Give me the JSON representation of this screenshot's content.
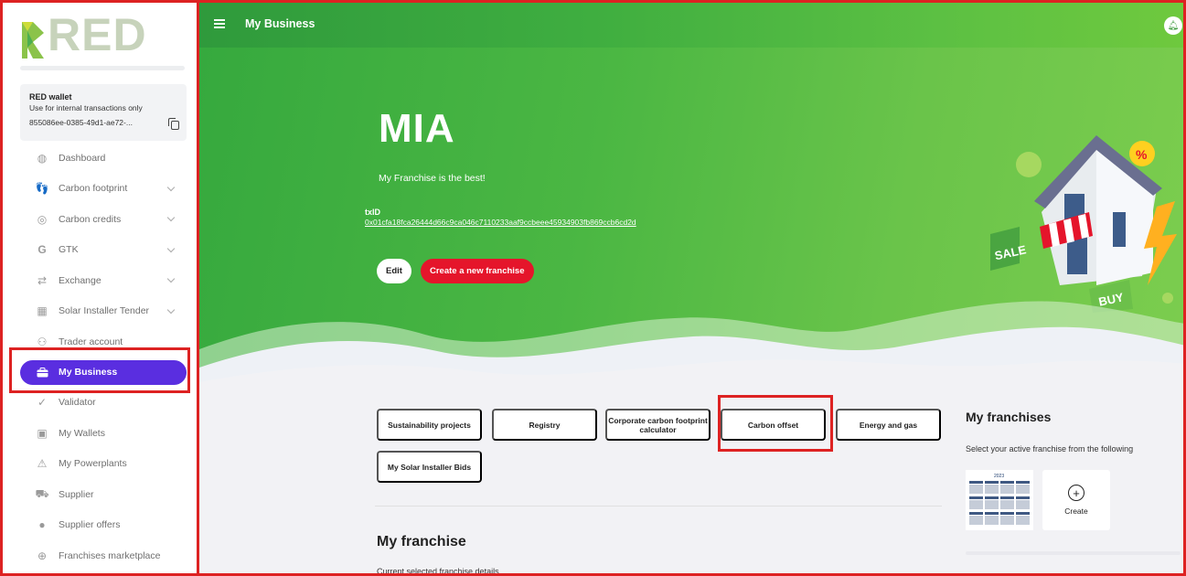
{
  "app": {
    "logo_text": "RED"
  },
  "wallet": {
    "title": "RED wallet",
    "subtitle": "Use for internal transactions only",
    "address": "855086ee-0385-49d1-ae72-..."
  },
  "sidebar": {
    "items": [
      {
        "label": "Dashboard",
        "icon": "dashboard-icon",
        "has_chevron": false
      },
      {
        "label": "Carbon footprint",
        "icon": "footprint-icon",
        "has_chevron": true
      },
      {
        "label": "Carbon credits",
        "icon": "credits-icon",
        "has_chevron": true
      },
      {
        "label": "GTK",
        "icon": "gtk-icon",
        "has_chevron": true
      },
      {
        "label": "Exchange",
        "icon": "exchange-icon",
        "has_chevron": true
      },
      {
        "label": "Solar Installer Tender",
        "icon": "solar-icon",
        "has_chevron": true
      },
      {
        "label": "Trader account",
        "icon": "trader-icon",
        "has_chevron": false
      },
      {
        "label": "My Business",
        "icon": "briefcase-icon",
        "has_chevron": false,
        "active": true
      },
      {
        "label": "Validator",
        "icon": "check-icon",
        "has_chevron": false
      },
      {
        "label": "My Wallets",
        "icon": "wallet-icon",
        "has_chevron": false
      },
      {
        "label": "My Powerplants",
        "icon": "powerplant-icon",
        "has_chevron": false
      },
      {
        "label": "Supplier",
        "icon": "truck-icon",
        "has_chevron": false
      },
      {
        "label": "Supplier offers",
        "icon": "offers-icon",
        "has_chevron": false
      },
      {
        "label": "Franchises marketplace",
        "icon": "marketplace-icon",
        "has_chevron": false
      }
    ]
  },
  "topbar": {
    "title": "My Business"
  },
  "hero": {
    "title": "MIA",
    "subtitle": "My Franchise is the best!",
    "txid_label": "txID",
    "txid_value": "0x01cfa18fca26444d66c9ca046c7110233aaf9ccbeee45934903fb869ccb6cd2d",
    "edit_label": "Edit",
    "create_label": "Create a new franchise",
    "illustration_labels": {
      "sale": "SALE",
      "buy": "BUY",
      "percent": "%"
    }
  },
  "categories": [
    {
      "label": "Sustainability projects"
    },
    {
      "label": "Registry"
    },
    {
      "label": "Corporate carbon footprint calculator"
    },
    {
      "label": "Carbon offset"
    },
    {
      "label": "Energy and gas"
    },
    {
      "label": "My Solar Installer Bids"
    }
  ],
  "franchise_section": {
    "title": "My franchise",
    "subtitle": "Current selected franchise details"
  },
  "my_franchises": {
    "title": "My franchises",
    "subtitle": "Select your active franchise from the following",
    "create_label": "Create",
    "thumb_year": "2023"
  },
  "colors": {
    "accent": "#5a2ee0",
    "danger": "#e5152b",
    "green": "#3fae40",
    "highlight": "#dd2222"
  }
}
